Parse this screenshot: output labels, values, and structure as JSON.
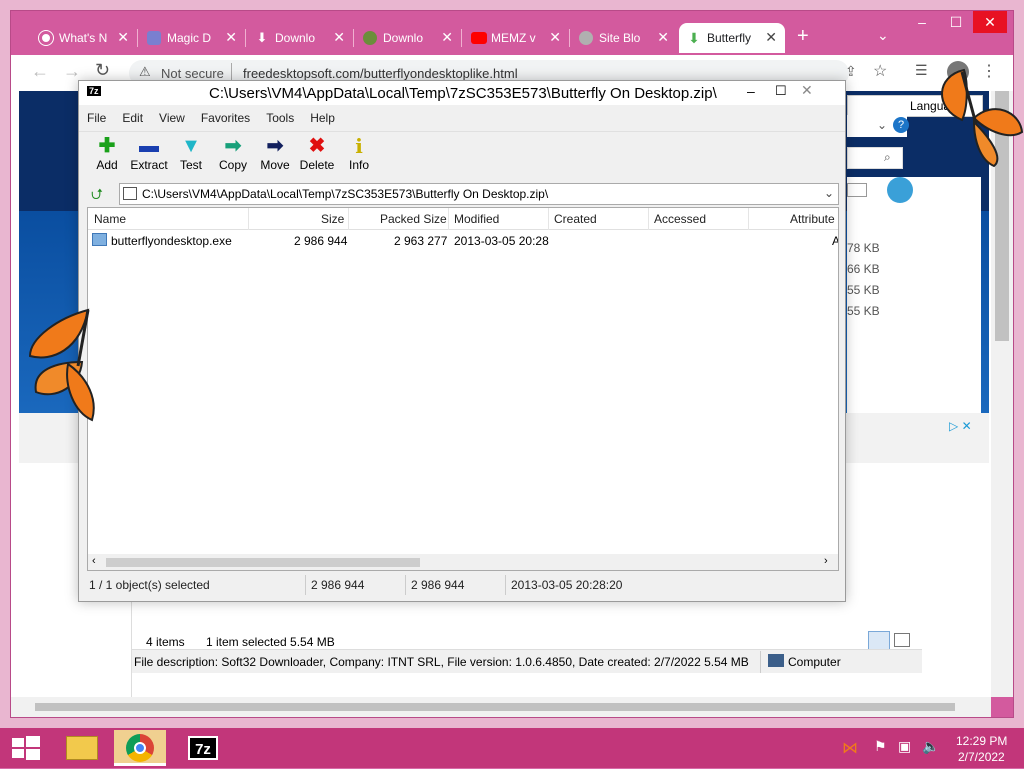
{
  "browser": {
    "tabs": [
      {
        "label": "What's N",
        "icon": "chrome-icon"
      },
      {
        "label": "Magic D",
        "icon": "magic-icon"
      },
      {
        "label": "Downlo",
        "icon": "download-icon"
      },
      {
        "label": "Downlo",
        "icon": "softpedia-icon"
      },
      {
        "label": "MEMZ v",
        "icon": "youtube-icon"
      },
      {
        "label": "Site Blo",
        "icon": "globe-icon"
      },
      {
        "label": "Butterfly",
        "icon": "download-green-icon"
      }
    ],
    "new_tab": "+",
    "url_security": "Not secure",
    "url": "freedesktopsoft.com/butterflyondesktoplike.html",
    "language_button": "Langua",
    "ad_choices": "▷ ✕"
  },
  "explorer_behind": {
    "sizes": [
      "78 KB",
      "66 KB",
      "55 KB",
      "55 KB"
    ],
    "items_count": "4 items",
    "selected": "1 item selected  5.54 MB",
    "file_description": "File description: Soft32 Downloader, Company: ITNT SRL, File version: 1.0.6.4850, Date created: 2/7/2022 5.54 MB",
    "computer": "Computer"
  },
  "zip": {
    "title": "C:\\Users\\VM4\\AppData\\Local\\Temp\\7zSC353E573\\Butterfly On Desktop.zip\\",
    "app_badge": "7z",
    "menu": [
      "File",
      "Edit",
      "View",
      "Favorites",
      "Tools",
      "Help"
    ],
    "toolbar": [
      {
        "label": "Add",
        "icon": "add-icon",
        "glyph": "✚",
        "color": "#1aa11a"
      },
      {
        "label": "Extract",
        "icon": "extract-icon",
        "glyph": "▬",
        "color": "#1a3fb0"
      },
      {
        "label": "Test",
        "icon": "test-icon",
        "glyph": "▼",
        "color": "#1fb6c8"
      },
      {
        "label": "Copy",
        "icon": "copy-icon",
        "glyph": "➡",
        "color": "#18a07a"
      },
      {
        "label": "Move",
        "icon": "move-icon",
        "glyph": "➡",
        "color": "#12205e"
      },
      {
        "label": "Delete",
        "icon": "delete-icon",
        "glyph": "✖",
        "color": "#e01010"
      },
      {
        "label": "Info",
        "icon": "info-icon",
        "glyph": "i",
        "color": "#c8b000"
      }
    ],
    "path": "C:\\Users\\VM4\\AppData\\Local\\Temp\\7zSC353E573\\Butterfly On Desktop.zip\\",
    "columns": [
      "Name",
      "Size",
      "Packed Size",
      "Modified",
      "Created",
      "Accessed",
      "Attribute"
    ],
    "rows": [
      {
        "name": "butterflyondesktop.exe",
        "size": "2 986 944",
        "packed": "2 963 277",
        "modified": "2013-03-05 20:28",
        "created": "",
        "accessed": "",
        "attr": "A"
      }
    ],
    "status": {
      "selected": "1 / 1 object(s) selected",
      "size": "2 986 944",
      "packed": "2 986 944",
      "date": "2013-03-05 20:28:20"
    }
  },
  "taskbar": {
    "time": "12:29 PM",
    "date": "2/7/2022"
  }
}
